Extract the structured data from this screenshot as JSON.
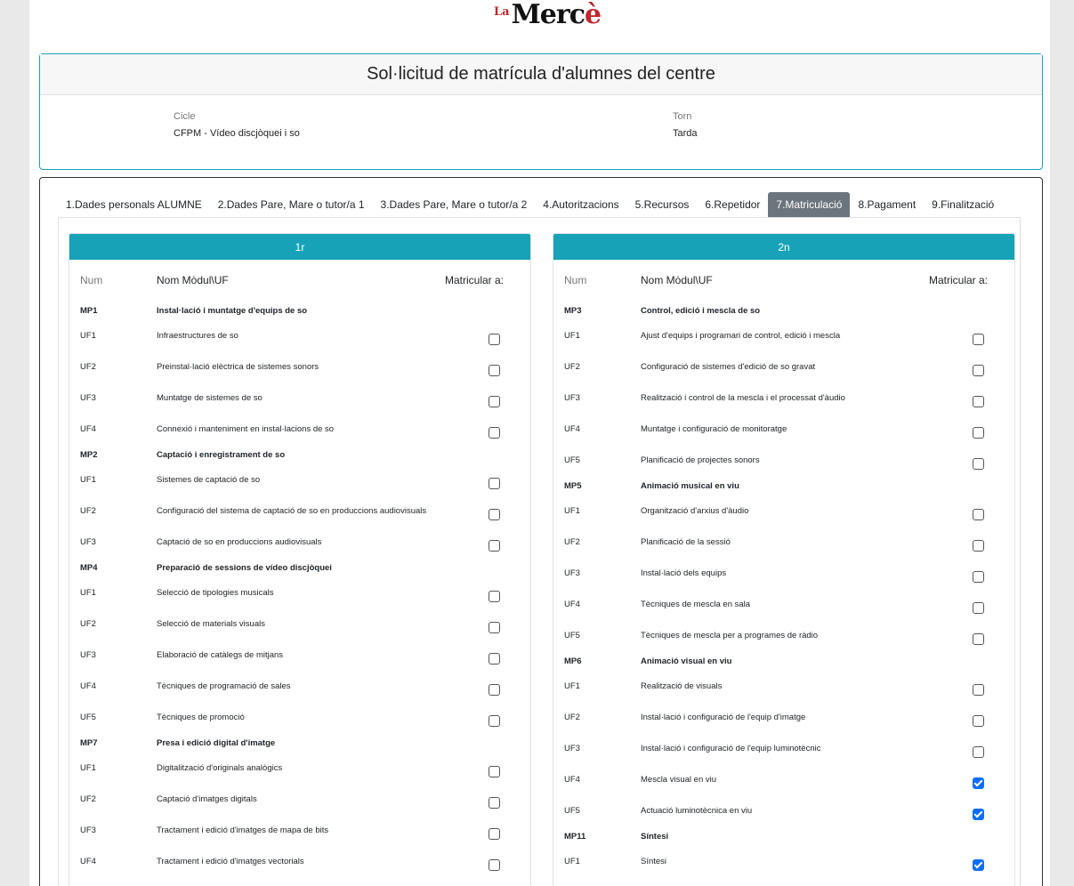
{
  "logo": {
    "prefix": "La",
    "word_a": "M",
    "word_b": "erc",
    "word_c": "è"
  },
  "request": {
    "title": "Sol·licitud de matrícula d'alumnes del centre",
    "cycle_label": "Cicle",
    "cycle_value": "CFPM - Vídeo discjòquei i so",
    "shift_label": "Torn",
    "shift_value": "Tarda"
  },
  "tabs": [
    {
      "label": "1.Dades personals ALUMNE",
      "active": false
    },
    {
      "label": "2.Dades Pare, Mare o tutor/a 1",
      "active": false
    },
    {
      "label": "3.Dades Pare, Mare o tutor/a 2",
      "active": false
    },
    {
      "label": "4.Autoritzacions",
      "active": false
    },
    {
      "label": "5.Recursos",
      "active": false
    },
    {
      "label": "6.Repetidor",
      "active": false
    },
    {
      "label": "7.Matriculació",
      "active": true
    },
    {
      "label": "8.Pagament",
      "active": false
    },
    {
      "label": "9.Finalització",
      "active": false
    }
  ],
  "columns": {
    "num": "Num",
    "name": "Nom Mòdul\\UF",
    "enroll": "Matricular a:"
  },
  "years": [
    {
      "title": "1r",
      "rows": [
        {
          "type": "module",
          "num": "MP1",
          "name": "Instal·lació i muntatge d'equips de so"
        },
        {
          "type": "unit",
          "num": "UF1",
          "name": "Infraestructures de so",
          "checked": false
        },
        {
          "type": "unit",
          "num": "UF2",
          "name": "Preinstal·lació elèctrica de sistemes sonors",
          "checked": false
        },
        {
          "type": "unit",
          "num": "UF3",
          "name": "Muntatge de sistemes de so",
          "checked": false
        },
        {
          "type": "unit",
          "num": "UF4",
          "name": "Connexió i manteniment en instal·lacions de so",
          "checked": false
        },
        {
          "type": "module",
          "num": "MP2",
          "name": "Captació i enregistrament de so"
        },
        {
          "type": "unit",
          "num": "UF1",
          "name": "Sistemes de captació de so",
          "checked": false
        },
        {
          "type": "unit",
          "num": "UF2",
          "name": "Configuració del sistema de captació de so en produccions audiovisuals",
          "checked": false
        },
        {
          "type": "unit",
          "num": "UF3",
          "name": "Captació de so en produccions audiovisuals",
          "checked": false
        },
        {
          "type": "module",
          "num": "MP4",
          "name": "Preparació de sessions de vídeo discjòquei"
        },
        {
          "type": "unit",
          "num": "UF1",
          "name": "Selecció de tipologies musicals",
          "checked": false
        },
        {
          "type": "unit",
          "num": "UF2",
          "name": "Selecció de materials visuals",
          "checked": false
        },
        {
          "type": "unit",
          "num": "UF3",
          "name": "Elaboració de catàlegs de mitjans",
          "checked": false
        },
        {
          "type": "unit",
          "num": "UF4",
          "name": "Tècniques de programació de sales",
          "checked": false
        },
        {
          "type": "unit",
          "num": "UF5",
          "name": "Tècniques de promoció",
          "checked": false
        },
        {
          "type": "module",
          "num": "MP7",
          "name": "Presa i edició digital d'imatge"
        },
        {
          "type": "unit",
          "num": "UF1",
          "name": "Digitalització d'originals analògics",
          "checked": false
        },
        {
          "type": "unit",
          "num": "UF2",
          "name": "Captació d'imatges digitals",
          "checked": false
        },
        {
          "type": "unit",
          "num": "UF3",
          "name": "Tractament i edició d'imatges de mapa de bits",
          "checked": false
        },
        {
          "type": "unit",
          "num": "UF4",
          "name": "Tractament i edició d'imatges vectorials",
          "checked": false
        }
      ]
    },
    {
      "title": "2n",
      "rows": [
        {
          "type": "module",
          "num": "MP3",
          "name": "Control, edició i mescla de so"
        },
        {
          "type": "unit",
          "num": "UF1",
          "name": "Ajust d'equips i programari de control, edició i mescla",
          "checked": false
        },
        {
          "type": "unit",
          "num": "UF2",
          "name": "Configuració de sistemes d'edició de so gravat",
          "checked": false
        },
        {
          "type": "unit",
          "num": "UF3",
          "name": "Realització i control de la mescla i el processat d'àudio",
          "checked": false
        },
        {
          "type": "unit",
          "num": "UF4",
          "name": "Muntatge i configuració de monitoratge",
          "checked": false
        },
        {
          "type": "unit",
          "num": "UF5",
          "name": "Planificació de projectes sonors",
          "checked": false
        },
        {
          "type": "module",
          "num": "MP5",
          "name": "Animació musical en viu"
        },
        {
          "type": "unit",
          "num": "UF1",
          "name": "Organització d'arxius d'àudio",
          "checked": false
        },
        {
          "type": "unit",
          "num": "UF2",
          "name": "Planificació de la sessió",
          "checked": false
        },
        {
          "type": "unit",
          "num": "UF3",
          "name": "Instal·lació dels equips",
          "checked": false
        },
        {
          "type": "unit",
          "num": "UF4",
          "name": "Tècniques de mescla en sala",
          "checked": false
        },
        {
          "type": "unit",
          "num": "UF5",
          "name": "Tècniques de mescla per a programes de ràdio",
          "checked": false
        },
        {
          "type": "module",
          "num": "MP6",
          "name": "Animació visual en viu"
        },
        {
          "type": "unit",
          "num": "UF1",
          "name": "Realització de visuals",
          "checked": false
        },
        {
          "type": "unit",
          "num": "UF2",
          "name": "Instal·lació i configuració de l'equip d'imatge",
          "checked": false
        },
        {
          "type": "unit",
          "num": "UF3",
          "name": "Instal·lació i configuració de l'equip luminotècnic",
          "checked": false
        },
        {
          "type": "unit",
          "num": "UF4",
          "name": "Mescla visual en viu",
          "checked": true
        },
        {
          "type": "unit",
          "num": "UF5",
          "name": "Actuació luminotècnica en viu",
          "checked": true
        },
        {
          "type": "module",
          "num": "MP11",
          "name": "Síntesi"
        },
        {
          "type": "unit",
          "num": "UF1",
          "name": "Síntesi",
          "checked": true
        }
      ]
    }
  ]
}
